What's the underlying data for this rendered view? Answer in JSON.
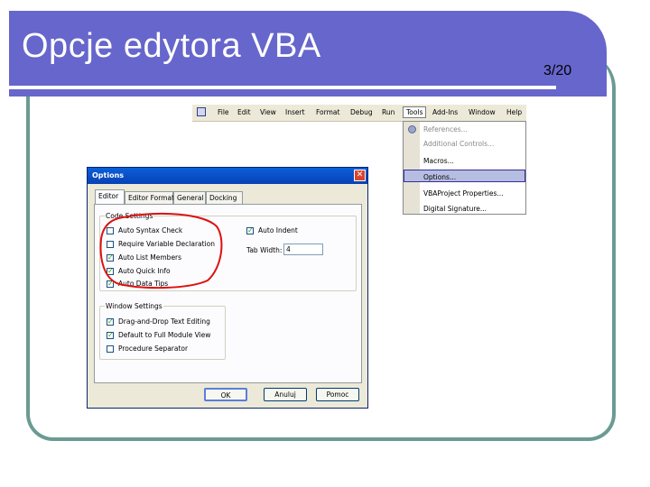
{
  "slide": {
    "title": "Opcje edytora VBA",
    "page_number": "3/20"
  },
  "menubar": {
    "items": [
      "File",
      "Edit",
      "View",
      "Insert",
      "Format",
      "Debug",
      "Run",
      "Tools",
      "Add-Ins",
      "Window",
      "Help"
    ],
    "active": "Tools"
  },
  "tools_menu": {
    "items": [
      "References...",
      "Additional Controls...",
      "Macros...",
      "Options...",
      "VBAProject Properties...",
      "Digital Signature..."
    ],
    "highlighted": "Options..."
  },
  "dialog": {
    "title": "Options",
    "tabs": [
      "Editor",
      "Editor Format",
      "General",
      "Docking"
    ],
    "active_tab": "Editor",
    "code_settings": {
      "label": "Code Settings",
      "options": [
        {
          "label": "Auto Syntax Check",
          "checked": false
        },
        {
          "label": "Require Variable Declaration",
          "checked": false
        },
        {
          "label": "Auto List Members",
          "checked": true
        },
        {
          "label": "Auto Quick Info",
          "checked": true
        },
        {
          "label": "Auto Data Tips",
          "checked": true
        }
      ],
      "auto_indent": {
        "label": "Auto Indent",
        "checked": true
      },
      "tab_width": {
        "label": "Tab Width:",
        "value": "4"
      }
    },
    "window_settings": {
      "label": "Window Settings",
      "options": [
        {
          "label": "Drag-and-Drop Text Editing",
          "checked": true
        },
        {
          "label": "Default to Full Module View",
          "checked": true
        },
        {
          "label": "Procedure Separator",
          "checked": false
        }
      ]
    },
    "buttons": {
      "ok": "OK",
      "cancel": "Anuluj",
      "help": "Pomoc"
    }
  },
  "colors": {
    "title_bar": "#6666cc",
    "frame": "#6b9b93",
    "annotation": "#dd1111"
  }
}
